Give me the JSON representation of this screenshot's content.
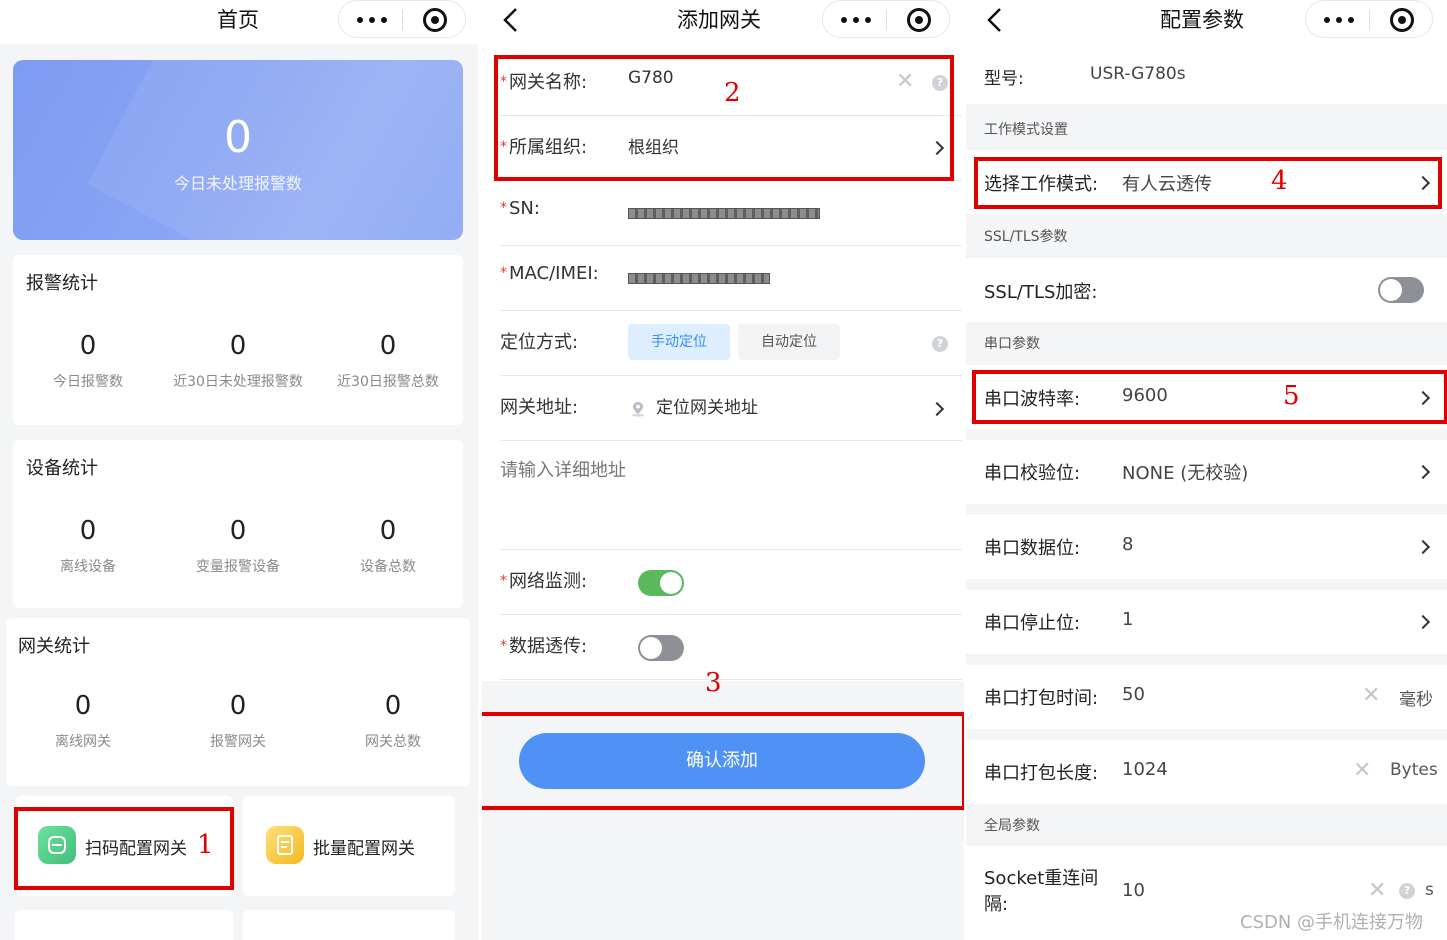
{
  "home": {
    "title": "首页",
    "hero": {
      "count": "0",
      "label": "今日未处理报警数"
    },
    "alarm_stats": {
      "title": "报警统计",
      "items": [
        {
          "value": "0",
          "label": "今日报警数"
        },
        {
          "value": "0",
          "label": "近30日未处理报警数"
        },
        {
          "value": "0",
          "label": "近30日报警总数"
        }
      ]
    },
    "device_stats": {
      "title": "设备统计",
      "items": [
        {
          "value": "0",
          "label": "离线设备"
        },
        {
          "value": "0",
          "label": "变量报警设备"
        },
        {
          "value": "0",
          "label": "设备总数"
        }
      ]
    },
    "gateway_stats": {
      "title": "网关统计",
      "items": [
        {
          "value": "0",
          "label": "离线网关"
        },
        {
          "value": "0",
          "label": "报警网关"
        },
        {
          "value": "0",
          "label": "网关总数"
        }
      ]
    },
    "tiles": {
      "scan": "扫码配置网关",
      "batch": "批量配置网关"
    },
    "annotation": "1"
  },
  "add_gateway": {
    "title": "添加网关",
    "name": {
      "label": "网关名称:",
      "value": "G780"
    },
    "org": {
      "label": "所属组织:",
      "value": "根组织"
    },
    "sn": {
      "label": "SN:"
    },
    "mac": {
      "label": "MAC/IMEI:"
    },
    "locate": {
      "label": "定位方式:",
      "manual": "手动定位",
      "auto": "自动定位"
    },
    "address": {
      "label": "网关地址:",
      "value": "定位网关地址"
    },
    "detail_placeholder": "请输入详细地址",
    "monitor": {
      "label": "网络监测:",
      "on": true
    },
    "passthrough": {
      "label": "数据透传:",
      "on": false
    },
    "confirm": "确认添加",
    "annotations": {
      "a2": "2",
      "a3": "3"
    }
  },
  "config": {
    "title": "配置参数",
    "model": {
      "label": "型号:",
      "value": "USR-G780s"
    },
    "sections": {
      "work_mode": "工作模式设置",
      "ssl": "SSL/TLS参数",
      "serial": "串口参数",
      "global": "全局参数"
    },
    "work_mode": {
      "label": "选择工作模式:",
      "value": "有人云透传"
    },
    "ssl": {
      "label": "SSL/TLS加密:",
      "on": false
    },
    "baud": {
      "label": "串口波特率:",
      "value": "9600"
    },
    "parity": {
      "label": "串口校验位:",
      "value": "NONE (无校验)"
    },
    "data_bits": {
      "label": "串口数据位:",
      "value": "8"
    },
    "stop_bits": {
      "label": "串口停止位:",
      "value": "1"
    },
    "pack_time": {
      "label": "串口打包时间:",
      "value": "50",
      "unit": "毫秒"
    },
    "pack_len": {
      "label": "串口打包长度:",
      "value": "1024",
      "unit": "Bytes"
    },
    "reconnect": {
      "label_line1": "Socket重连间",
      "label_line2": "隔:",
      "value": "10",
      "unit": "s"
    },
    "annotations": {
      "a4": "4",
      "a5": "5"
    }
  },
  "watermark": "CSDN @手机连接万物",
  "colors": {
    "primary": "#4f91f5",
    "toggle_on": "#5cb85c",
    "annotation": "#e00000",
    "hero": "#8aa4f4"
  }
}
